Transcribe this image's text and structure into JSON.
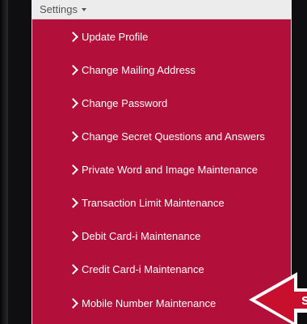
{
  "settings": {
    "label": "Settings"
  },
  "menu": {
    "items": [
      {
        "label": "Update Profile"
      },
      {
        "label": "Change Mailing Address"
      },
      {
        "label": "Change Password"
      },
      {
        "label": "Change Secret Questions and Answers"
      },
      {
        "label": "Private Word and Image Maintenance"
      },
      {
        "label": "Transaction Limit Maintenance"
      },
      {
        "label": "Debit Card-i Maintenance"
      },
      {
        "label": "Credit Card-i Maintenance"
      },
      {
        "label": "Mobile Number Maintenance"
      }
    ]
  },
  "colors": {
    "menu_background": "#b20f3a",
    "settings_bar": "#ececec",
    "item_text": "#ffffff",
    "pointer_arrow": "#c8102e"
  },
  "icons": {
    "menu_item": "chevron-right-icon",
    "settings": "caret-down-icon",
    "pointer": "arrow-left-icon"
  }
}
